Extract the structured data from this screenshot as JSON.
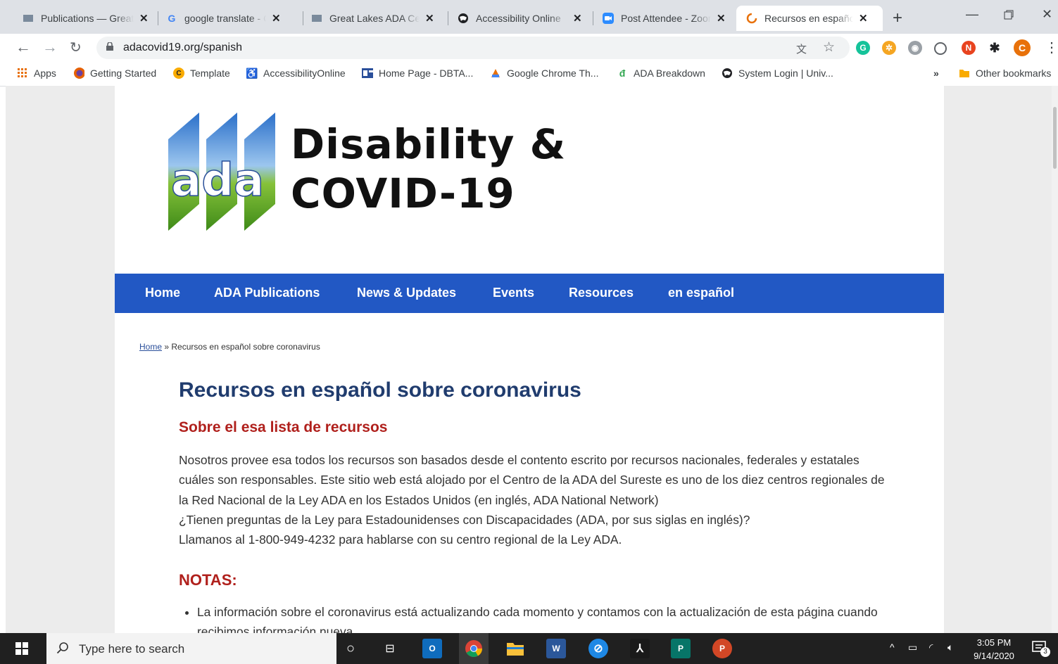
{
  "browser": {
    "tabs": [
      {
        "title": "Publications — Great Lakes",
        "icon": "ada-favicon-icon"
      },
      {
        "title": "google translate - Google",
        "icon": "google-icon"
      },
      {
        "title": "Great Lakes ADA Center",
        "icon": "ada-favicon-icon"
      },
      {
        "title": "Accessibility Online",
        "icon": "globe-icon"
      },
      {
        "title": "Post Attendee - Zoom",
        "icon": "zoom-icon"
      },
      {
        "title": "Recursos en español sobre",
        "icon": "loading-icon",
        "active": true
      }
    ],
    "url": "adacovid19.org/spanish",
    "bookmarks": [
      {
        "label": "Apps"
      },
      {
        "label": "Getting Started"
      },
      {
        "label": "Template"
      },
      {
        "label": "AccessibilityOnline"
      },
      {
        "label": "Home Page - DBTA..."
      },
      {
        "label": "Google Chrome Th..."
      },
      {
        "label": "ADA Breakdown"
      },
      {
        "label": "System Login | Univ..."
      }
    ],
    "more_bookmarks": "»",
    "other_bookmarks": "Other bookmarks",
    "profile_initial": "C",
    "ext_initial": "N"
  },
  "site": {
    "logo_text": "ada",
    "title_line1": "Disability &",
    "title_line2": "COVID-19",
    "nav": [
      "Home",
      "ADA Publications",
      "News & Updates",
      "Events",
      "Resources",
      "en español"
    ],
    "breadcrumb_home": "Home",
    "breadcrumb_sep": "»",
    "breadcrumb_current": "Recursos en español sobre coronavirus",
    "heading": "Recursos en español sobre coronavirus",
    "subheading": "Sobre el esa lista de recursos",
    "paragraph1": "Nosotros provee esa todos los recursos son basados desde el contento escrito por recursos nacionales, federales y estatales cuáles son responsables. Este sitio web está alojado por el Centro de la ADA del Sureste es uno de los diez centros regionales de la Red Nacional de la Ley ADA en los Estados Unidos (en inglés, ADA National Network)",
    "paragraph2": "¿Tienen preguntas de la Ley para Estadounidenses con Discapacidades (ADA, por sus siglas en inglés)?",
    "paragraph3": "Llamanos al 1-800-949-4232 para hablarse con su centro regional de la Ley ADA.",
    "notes_heading": "NOTAS:",
    "notes": [
      "La información sobre el coronavirus está actualizando cada momento y contamos con la actualización de esta página cuando recibimos información nueva"
    ]
  },
  "taskbar": {
    "search_placeholder": "Type here to search",
    "time": "3:05 PM",
    "date": "9/14/2020",
    "notification_count": "3"
  },
  "colors": {
    "nav_blue": "#2258c4",
    "heading_navy": "#203c6e",
    "subheading_red": "#b0201c"
  }
}
